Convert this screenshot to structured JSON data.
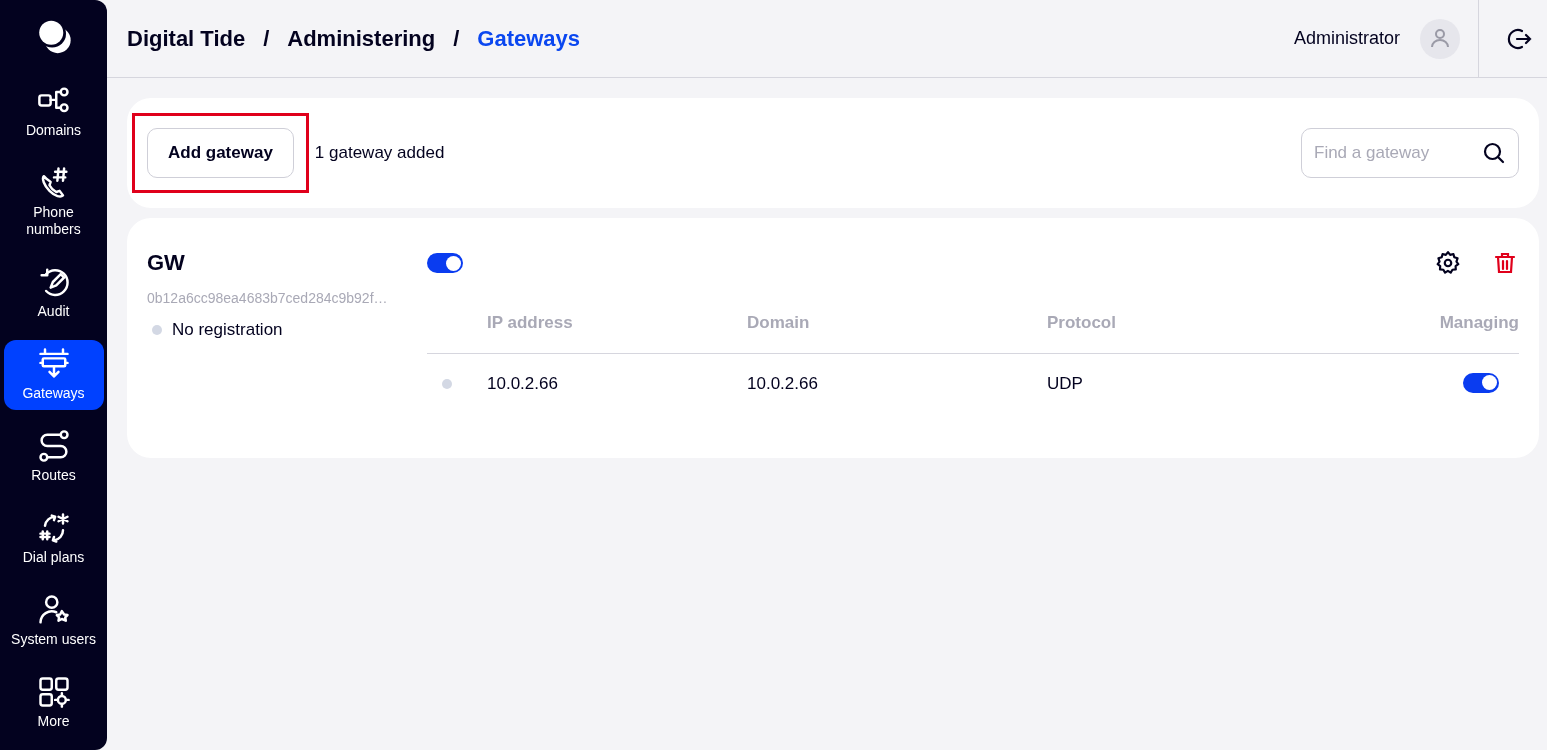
{
  "sidebar": {
    "items": [
      {
        "kind": "domains",
        "label": "Domains",
        "selected": false
      },
      {
        "kind": "phone",
        "label": "Phone numbers",
        "selected": false
      },
      {
        "kind": "audit",
        "label": "Audit",
        "selected": false
      },
      {
        "kind": "gateways",
        "label": "Gateways",
        "selected": true
      },
      {
        "kind": "routes",
        "label": "Routes",
        "selected": false
      },
      {
        "kind": "dialplans",
        "label": "Dial plans",
        "selected": false
      },
      {
        "kind": "users",
        "label": "System users",
        "selected": false
      },
      {
        "kind": "more",
        "label": "More",
        "selected": false
      }
    ]
  },
  "breadcrumb": [
    {
      "label": "Digital Tide",
      "selected": false
    },
    {
      "label": "Administering",
      "selected": false
    },
    {
      "label": "Gateways",
      "selected": true
    }
  ],
  "breadcrumb_separator": "/",
  "user": {
    "name": "Administrator"
  },
  "toolbar": {
    "add_button": {
      "label": "Add gateway",
      "highlighted": true
    },
    "count": "1 gateway added",
    "search": {
      "placeholder": "Find a gateway"
    }
  },
  "gateways": [
    {
      "name": "GW",
      "id": "0b12a6cc98ea4683b7ced284c9b92f…",
      "status": "No registration",
      "enabled": true,
      "columns": [
        "IP address",
        "Domain",
        "Protocol",
        "Managing"
      ],
      "rows": [
        {
          "ip": "10.0.2.66",
          "domain": "10.0.2.66",
          "protocol": "UDP",
          "managing": true
        }
      ]
    }
  ]
}
